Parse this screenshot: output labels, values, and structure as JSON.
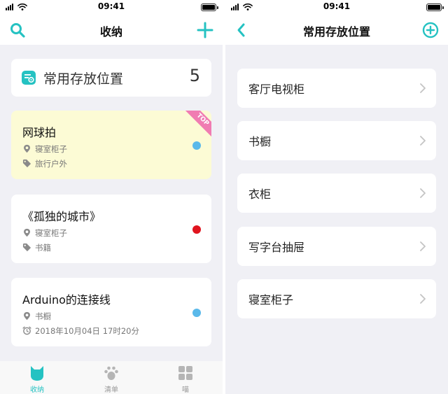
{
  "status_bar": {
    "time": "09:41"
  },
  "left_screen": {
    "title": "收纳",
    "summary": {
      "label": "常用存放位置",
      "count": "5"
    },
    "items": [
      {
        "title": "网球拍",
        "location": "寝室柜子",
        "tag": "旅行户外",
        "badge": "TOP",
        "dot_color": "#5ab9ea",
        "pinned": true
      },
      {
        "title": "《孤独的城市》",
        "location": "寝室柜子",
        "tag": "书籍",
        "dot_color": "#e0141e",
        "pinned": false
      },
      {
        "title": "Arduino的连接线",
        "location": "书橱",
        "datetime": "2018年10月04日 17时20分",
        "dot_color": "#5ab9ea",
        "pinned": false
      }
    ],
    "tabs": [
      {
        "label": "收纳",
        "icon": "cat-icon",
        "active": true
      },
      {
        "label": "清单",
        "icon": "paw-icon",
        "active": false
      },
      {
        "label": "喵",
        "icon": "grid-icon",
        "active": false
      }
    ]
  },
  "right_screen": {
    "title": "常用存放位置",
    "locations": [
      {
        "label": "客厅电视柜"
      },
      {
        "label": "书橱"
      },
      {
        "label": "衣柜"
      },
      {
        "label": "写字台抽屉"
      },
      {
        "label": "寝室柜子"
      }
    ]
  },
  "colors": {
    "accent": "#25c2c2",
    "page_background": "#f0f0f5",
    "pinned_background": "#fcfbd5",
    "ribbon": "#f07cb2"
  }
}
